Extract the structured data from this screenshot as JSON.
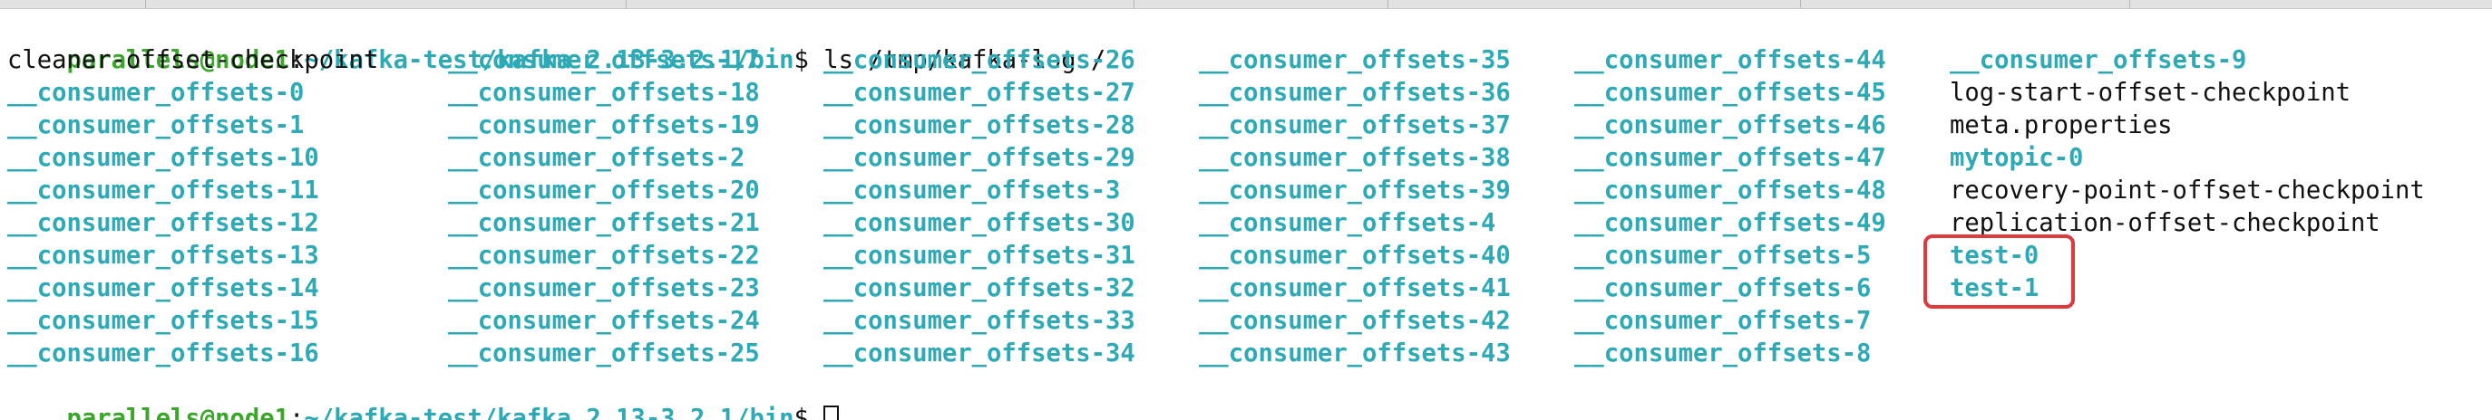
{
  "terminal": {
    "prompt_user": "parallels@node1",
    "prompt_sep": ":",
    "prompt_path": "~/kafka-test/kafka_2.13-3.2.1/bin",
    "prompt_symbol": "$ ",
    "command": "ls /tmp/kafka-logs/",
    "colors": {
      "user": "#3aa62a",
      "directory": "#2eaab7",
      "text": "#111111",
      "highlight": "#e0393b"
    },
    "listing": [
      [
        {
          "text": "cleaner-offset-checkpoint",
          "kind": "file"
        },
        {
          "text": "__consumer_offsets-0",
          "kind": "dir"
        },
        {
          "text": "__consumer_offsets-1",
          "kind": "dir"
        },
        {
          "text": "__consumer_offsets-10",
          "kind": "dir"
        },
        {
          "text": "__consumer_offsets-11",
          "kind": "dir"
        },
        {
          "text": "__consumer_offsets-12",
          "kind": "dir"
        },
        {
          "text": "__consumer_offsets-13",
          "kind": "dir"
        },
        {
          "text": "__consumer_offsets-14",
          "kind": "dir"
        },
        {
          "text": "__consumer_offsets-15",
          "kind": "dir"
        },
        {
          "text": "__consumer_offsets-16",
          "kind": "dir"
        }
      ],
      [
        {
          "text": "__consumer_offsets-17",
          "kind": "dir"
        },
        {
          "text": "__consumer_offsets-18",
          "kind": "dir"
        },
        {
          "text": "__consumer_offsets-19",
          "kind": "dir"
        },
        {
          "text": "__consumer_offsets-2",
          "kind": "dir"
        },
        {
          "text": "__consumer_offsets-20",
          "kind": "dir"
        },
        {
          "text": "__consumer_offsets-21",
          "kind": "dir"
        },
        {
          "text": "__consumer_offsets-22",
          "kind": "dir"
        },
        {
          "text": "__consumer_offsets-23",
          "kind": "dir"
        },
        {
          "text": "__consumer_offsets-24",
          "kind": "dir"
        },
        {
          "text": "__consumer_offsets-25",
          "kind": "dir"
        }
      ],
      [
        {
          "text": "__consumer_offsets-26",
          "kind": "dir"
        },
        {
          "text": "__consumer_offsets-27",
          "kind": "dir"
        },
        {
          "text": "__consumer_offsets-28",
          "kind": "dir"
        },
        {
          "text": "__consumer_offsets-29",
          "kind": "dir"
        },
        {
          "text": "__consumer_offsets-3",
          "kind": "dir"
        },
        {
          "text": "__consumer_offsets-30",
          "kind": "dir"
        },
        {
          "text": "__consumer_offsets-31",
          "kind": "dir"
        },
        {
          "text": "__consumer_offsets-32",
          "kind": "dir"
        },
        {
          "text": "__consumer_offsets-33",
          "kind": "dir"
        },
        {
          "text": "__consumer_offsets-34",
          "kind": "dir"
        }
      ],
      [
        {
          "text": "__consumer_offsets-35",
          "kind": "dir"
        },
        {
          "text": "__consumer_offsets-36",
          "kind": "dir"
        },
        {
          "text": "__consumer_offsets-37",
          "kind": "dir"
        },
        {
          "text": "__consumer_offsets-38",
          "kind": "dir"
        },
        {
          "text": "__consumer_offsets-39",
          "kind": "dir"
        },
        {
          "text": "__consumer_offsets-4",
          "kind": "dir"
        },
        {
          "text": "__consumer_offsets-40",
          "kind": "dir"
        },
        {
          "text": "__consumer_offsets-41",
          "kind": "dir"
        },
        {
          "text": "__consumer_offsets-42",
          "kind": "dir"
        },
        {
          "text": "__consumer_offsets-43",
          "kind": "dir"
        }
      ],
      [
        {
          "text": "__consumer_offsets-44",
          "kind": "dir"
        },
        {
          "text": "__consumer_offsets-45",
          "kind": "dir"
        },
        {
          "text": "__consumer_offsets-46",
          "kind": "dir"
        },
        {
          "text": "__consumer_offsets-47",
          "kind": "dir"
        },
        {
          "text": "__consumer_offsets-48",
          "kind": "dir"
        },
        {
          "text": "__consumer_offsets-49",
          "kind": "dir"
        },
        {
          "text": "__consumer_offsets-5",
          "kind": "dir"
        },
        {
          "text": "__consumer_offsets-6",
          "kind": "dir"
        },
        {
          "text": "__consumer_offsets-7",
          "kind": "dir"
        },
        {
          "text": "__consumer_offsets-8",
          "kind": "dir"
        }
      ],
      [
        {
          "text": "__consumer_offsets-9",
          "kind": "dir"
        },
        {
          "text": "log-start-offset-checkpoint",
          "kind": "file"
        },
        {
          "text": "meta.properties",
          "kind": "file"
        },
        {
          "text": "mytopic-0",
          "kind": "dir"
        },
        {
          "text": "recovery-point-offset-checkpoint",
          "kind": "file"
        },
        {
          "text": "replication-offset-checkpoint",
          "kind": "file"
        },
        {
          "text": "test-0",
          "kind": "dir"
        },
        {
          "text": "test-1",
          "kind": "dir"
        }
      ]
    ]
  }
}
